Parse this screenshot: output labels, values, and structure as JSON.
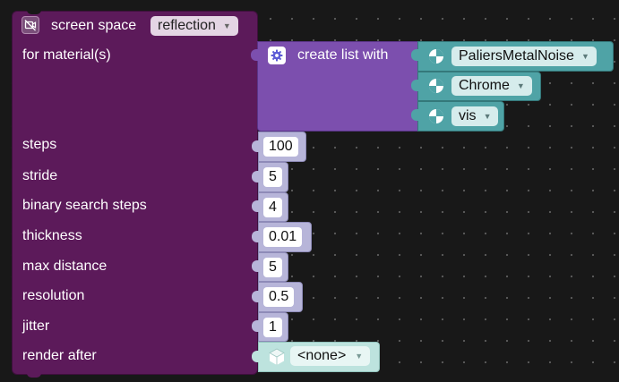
{
  "main_block": {
    "title": "screen space",
    "mode": "reflection",
    "camera_icon": "camera-off-icon",
    "color": "#5c1a5a"
  },
  "labels": {
    "materials": "for material(s)",
    "steps": "steps",
    "stride": "stride",
    "binary_search_steps": "binary search steps",
    "thickness": "thickness",
    "max_distance": "max distance",
    "resolution": "resolution",
    "jitter": "jitter",
    "render_after": "render after"
  },
  "list_block": {
    "label": "create list with",
    "gear_icon": "gear-icon",
    "color": "#7c4fae"
  },
  "materials": [
    {
      "name": "PaliersMetalNoise",
      "icon": "material-sphere-icon"
    },
    {
      "name": "Chrome",
      "icon": "material-sphere-icon"
    },
    {
      "name": "vis",
      "icon": "material-sphere-icon"
    }
  ],
  "values": {
    "steps": "100",
    "stride": "5",
    "binary_search_steps": "4",
    "thickness": "0.01",
    "max_distance": "5",
    "resolution": "0.5",
    "jitter": "1"
  },
  "render_after": {
    "value": "<none>",
    "icon": "cube-icon"
  },
  "colors": {
    "workspace_bg": "#181818",
    "material_block": "#4fa3a6",
    "number_block": "#b7b5d9",
    "render_block": "#bde3de"
  }
}
